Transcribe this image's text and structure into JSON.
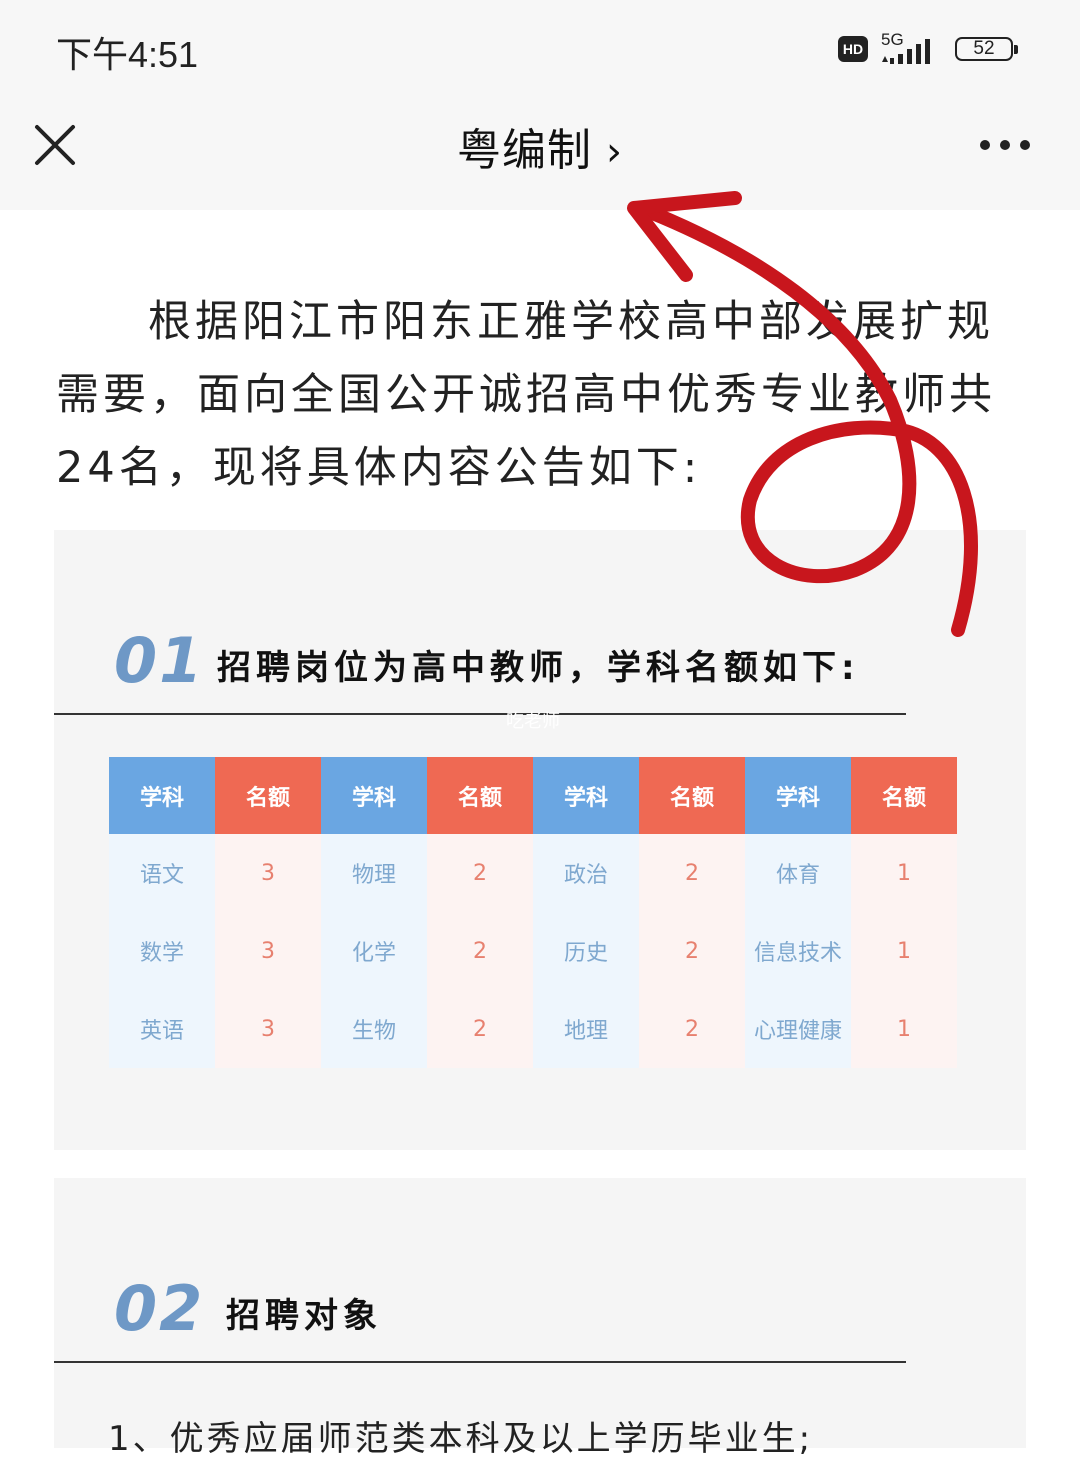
{
  "status_bar": {
    "time": "下午4:51",
    "hd": "HD",
    "network": "5G",
    "battery": "52"
  },
  "nav": {
    "title": "粤编制",
    "chevron": "›",
    "close_icon": "close-icon",
    "more_icon": "more-icon"
  },
  "intro": {
    "text": "根据阳江市阳东正雅学校高中部发展扩规需要，面向全国公开诚招高中优秀专业教师共24名，现将具体内容公告如下:"
  },
  "section1": {
    "number": "01",
    "title": "招聘岗位为高中教师，学科名额如下:",
    "watermark": "吃老师",
    "table": {
      "headers": [
        "学科",
        "名额",
        "学科",
        "名额",
        "学科",
        "名额",
        "学科",
        "名额"
      ],
      "rows": [
        [
          "语文",
          "3",
          "物理",
          "2",
          "政治",
          "2",
          "体育",
          "1"
        ],
        [
          "数学",
          "3",
          "化学",
          "2",
          "历史",
          "2",
          "信息技术",
          "1"
        ],
        [
          "英语",
          "3",
          "生物",
          "2",
          "地理",
          "2",
          "心理健康",
          "1"
        ]
      ]
    }
  },
  "section2": {
    "number": "02",
    "title": "招聘对象",
    "item1": "1、优秀应届师范类本科及以上学历毕业生;"
  },
  "colors": {
    "accent_blue": "#6e98c6",
    "header_blue": "#6aa6e2",
    "header_red": "#ef6953",
    "annotation_red": "#c8161d"
  }
}
